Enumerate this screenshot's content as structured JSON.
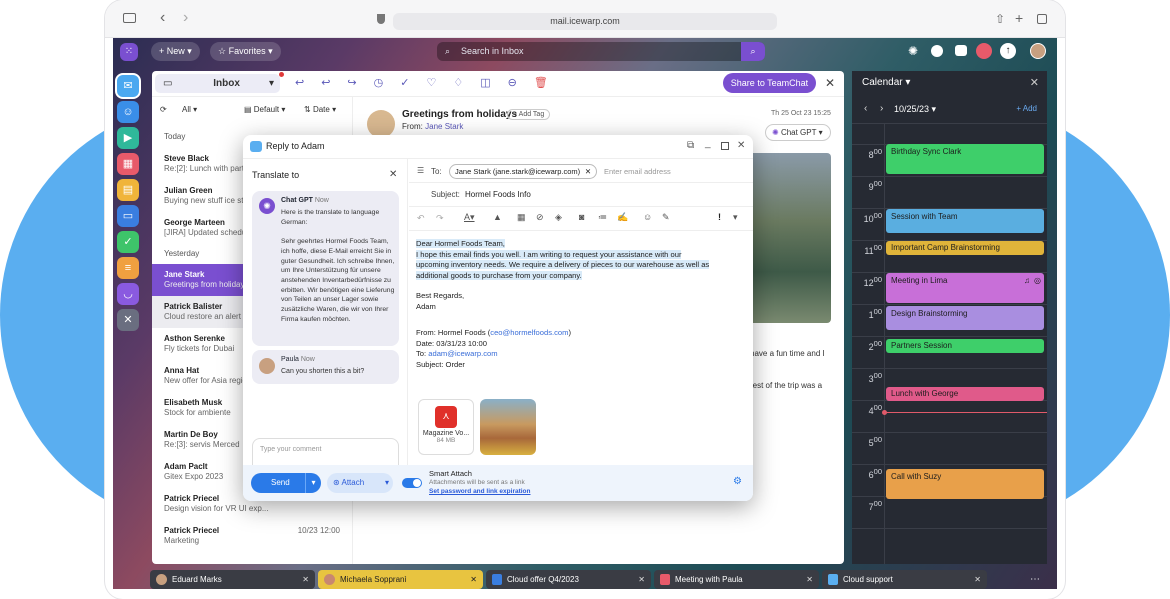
{
  "browser": {
    "url": "mail.icewarp.com"
  },
  "topbar": {
    "new_label": "New",
    "favorites_label": "Favorites",
    "search_placeholder": "Search in Inbox"
  },
  "mail_toolbar": {
    "folder": "Inbox",
    "share": "Share to TeamChat"
  },
  "list_toolbar": {
    "filter": "All",
    "view": "Default",
    "sort": "Date"
  },
  "groups": {
    "today": "Today",
    "yesterday": "Yesterday"
  },
  "mail_list": [
    {
      "name": "Steve Black",
      "preview": "Re:[2]: Lunch with partn",
      "time": ""
    },
    {
      "name": "Julian Green",
      "preview": "Buying new stuff ice st",
      "time": ""
    },
    {
      "name": "George Marteen",
      "preview": "[JIRA] Updated schedul",
      "time": ""
    },
    {
      "name": "Jane Stark",
      "preview": "Greetings from holiday",
      "time": ""
    },
    {
      "name": "Patrick Balister",
      "preview": "Cloud restore an alert",
      "time": ""
    },
    {
      "name": "Asthon Serenke",
      "preview": "Fly tickets for Dubai",
      "time": ""
    },
    {
      "name": "Anna Hat",
      "preview": "New offer for Asia regio",
      "time": ""
    },
    {
      "name": "Elisabeth Musk",
      "preview": "Stock for ambiente",
      "time": ""
    },
    {
      "name": "Martin De Boy",
      "preview": "Re:[3]: servis Merced",
      "time": ""
    },
    {
      "name": "Adam Paclt",
      "preview": "Gitex Expo 2023",
      "time": ""
    },
    {
      "name": "Patrick Priecel",
      "preview": "Design vision for VR UI exp...",
      "time": ""
    },
    {
      "name": "Patrick Priecel",
      "preview": "Marketing",
      "time": "10/23 12:00"
    }
  ],
  "message": {
    "subject": "Greetings from holidays",
    "add_tag": "+ Add Tag",
    "from_label": "From:",
    "from": "Jane Stark",
    "date": "Th 25 Oct 23 15:25",
    "chatgpt": "Chat GPT",
    "body1": "have a fun time and I",
    "body2": "rest of the trip was a"
  },
  "dialog": {
    "title": "Reply to Adam",
    "translate_title": "Translate to",
    "gpt_name": "Chat GPT",
    "gpt_time": "Now",
    "gpt_text": "Here is the translate to language German:\n\nSehr geehrtes Hormel Foods Team, ich hoffe, diese E-Mail erreicht Sie in guter Gesundheit. Ich schreibe Ihnen, um Ihre Unterstützung für unsere anstehenden Inventarbedürfnisse zu erbitten. Wir benötigen eine Lieferung von Teilen an unser Lager sowie zusätzliche Waren, die wir von Ihrer Firma kaufen möchten.",
    "paula_name": "Paula",
    "paula_time": "Now",
    "paula_text": "Can you shorten this a bit?",
    "comment_placeholder": "Type your comment",
    "to_label": "To:",
    "to_chip": "Jane Stark (jane.stark@icewarp.com)",
    "to_placeholder": "Enter email address",
    "subject_label": "Subject:",
    "subject": "Hormel Foods Info",
    "greeting": "Dear Hormel Foods Team,",
    "body": "I hope this email finds you well. I am writing to request your assistance with our upcoming inventory needs. We require a delivery of pieces to our warehouse as well as additional goods to purchase from your company.",
    "regards": "Best Regards,",
    "sign": "Adam",
    "q_from": "From: Hormel Foods (",
    "q_email": "ceo@hormelfoods.com",
    "q_from_end": ")",
    "q_date": "Date: 03/31/23 10:00",
    "q_to": "To: ",
    "q_to_email": "adam@icewarp.com",
    "q_subject": "Subject: Order",
    "attach_name": "Magazine Vo...",
    "attach_size": "84 MB",
    "send": "Send",
    "attach": "Attach",
    "smart_title": "Smart Attach",
    "smart_sub": "Attachments will be sent as a link",
    "smart_link": "Set password and link expiration"
  },
  "calendar": {
    "title": "Calendar",
    "date": "10/25/23",
    "add": "+ Add",
    "hours": [
      "8",
      "9",
      "10",
      "11",
      "12",
      "1",
      "2",
      "3",
      "4",
      "5",
      "6",
      "7"
    ],
    "events": [
      {
        "title": "Birthday Sync Clark",
        "color": "#3ecf6a"
      },
      {
        "title": "Session with Team",
        "color": "#5aaee0"
      },
      {
        "title": "Important Camp Brainstorming",
        "color": "#e0b43a"
      },
      {
        "title": "Meeting in Lima",
        "color": "#c86fd8"
      },
      {
        "title": "Design Brainstorming",
        "color": "#a98ee0"
      },
      {
        "title": "Partners Session",
        "color": "#3ecf6a"
      },
      {
        "title": "Lunch with George",
        "color": "#e05a8a"
      },
      {
        "title": "Call with Suzy",
        "color": "#e8a04a"
      }
    ]
  },
  "taskbar": [
    {
      "label": "Eduard Marks"
    },
    {
      "label": "Michaela Soppranì"
    },
    {
      "label": "Cloud offer Q4/2023"
    },
    {
      "label": "Meeting with Paula"
    },
    {
      "label": "Cloud support"
    }
  ]
}
